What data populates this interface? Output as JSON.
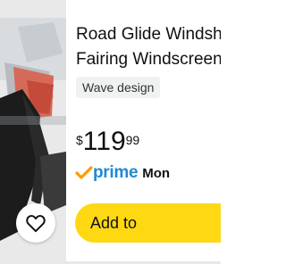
{
  "product": {
    "title_line1": "Road Glide Windsh",
    "title_line2": "Fairing Windscreen",
    "style_chip": "Wave design",
    "price": {
      "symbol": "$",
      "whole": "119",
      "fraction": "99"
    },
    "prime_label": "prime",
    "delivery_text": "Mon",
    "add_button_label": "Add to"
  },
  "icons": {
    "favorite": "heart-outline-icon",
    "prime_check": "prime-check-icon"
  },
  "colors": {
    "add_button": "#ffd814",
    "prime_blue": "#1f8ad6",
    "prime_check_orange": "#ff9900",
    "text": "#0f1111"
  }
}
